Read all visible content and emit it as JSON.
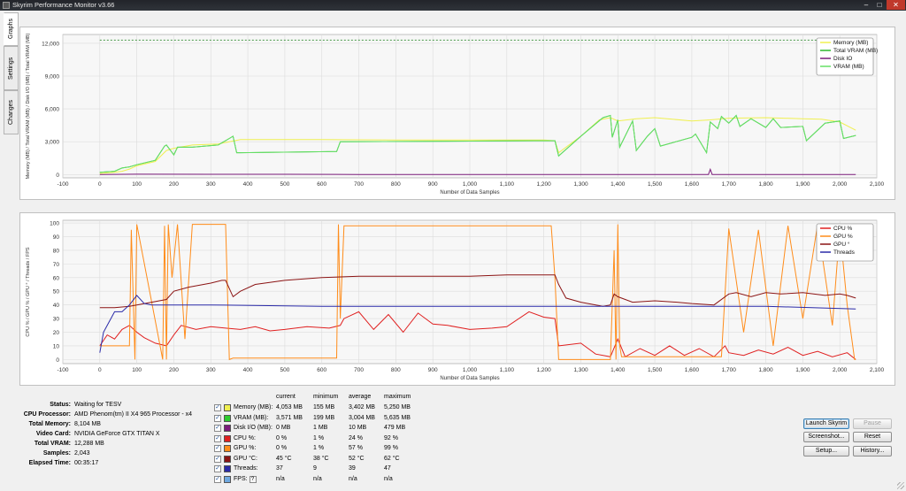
{
  "window": {
    "title": "Skyrim Performance Monitor v3.66",
    "minimize_glyph": "–",
    "maximize_glyph": "□",
    "close_glyph": "✕"
  },
  "tabs": [
    {
      "label": "Graphs",
      "active": true
    },
    {
      "label": "Settings",
      "active": false
    },
    {
      "label": "Changes",
      "active": false
    }
  ],
  "chart_data": [
    {
      "type": "line",
      "ylabel": "Memory (MB) / Total VRAM (MB) / Disk I/O (MB) / Total VRAM (MB)",
      "xlabel": "Number of Data Samples",
      "xlim": [
        -100,
        2100
      ],
      "ylim": [
        -300,
        12800
      ],
      "x_ticks": [
        "-100",
        "0",
        "100",
        "200",
        "300",
        "400",
        "500",
        "600",
        "700",
        "800",
        "900",
        "1,000",
        "1,100",
        "1,200",
        "1,300",
        "1,400",
        "1,500",
        "1,600",
        "1,700",
        "1,800",
        "1,900",
        "2,000",
        "2,100"
      ],
      "y_ticks": [
        "0",
        "3,000",
        "6,000",
        "9,000",
        "12,000"
      ],
      "grid": true,
      "legend_position": "top-right",
      "reference_line": {
        "value": 12288,
        "color": "#2e8b2e"
      },
      "series": [
        {
          "name": "Memory (MB)",
          "color": "#f0f050",
          "x": [
            0,
            40,
            60,
            80,
            100,
            150,
            180,
            200,
            250,
            320,
            350,
            380,
            400,
            600,
            800,
            1000,
            1200,
            1230,
            1240,
            1300,
            1350,
            1380,
            1400,
            1450,
            1500,
            1600,
            1650,
            1700,
            1800,
            1900,
            1950,
            2000,
            2043
          ],
          "y": [
            100,
            200,
            300,
            500,
            800,
            1200,
            2200,
            2400,
            2700,
            2800,
            3000,
            3200,
            3200,
            3200,
            3150,
            3150,
            3150,
            3100,
            2000,
            3500,
            5000,
            5200,
            4900,
            5100,
            5200,
            4900,
            5000,
            5150,
            5200,
            5100,
            5050,
            4800,
            4053
          ]
        },
        {
          "name": "Total VRAM (MB)",
          "color": "#2db82d",
          "x": [
            0,
            40,
            60,
            80,
            100,
            150,
            175,
            180,
            200,
            210,
            250,
            320,
            360,
            370,
            380,
            640,
            650,
            1230,
            1240,
            1300,
            1360,
            1380,
            1385,
            1400,
            1405,
            1440,
            1450,
            1480,
            1500,
            1515,
            1600,
            1610,
            1640,
            1650,
            1670,
            1680,
            1700,
            1720,
            1730,
            1760,
            1800,
            1820,
            1840,
            1900,
            1910,
            1960,
            2000,
            2010,
            2043
          ],
          "y": [
            200,
            300,
            600,
            700,
            900,
            1300,
            2600,
            2700,
            1800,
            2500,
            2500,
            2700,
            3500,
            2000,
            2000,
            2100,
            3000,
            3100,
            1700,
            3500,
            5200,
            5400,
            3400,
            5000,
            2500,
            4900,
            2200,
            3500,
            4200,
            2600,
            3400,
            3700,
            2000,
            4800,
            4200,
            5300,
            4700,
            5400,
            4400,
            5100,
            4300,
            5100,
            4300,
            4400,
            3100,
            4700,
            4900,
            3300,
            3571
          ]
        },
        {
          "name": "Disk IO",
          "color": "#7b1c7b",
          "x": [
            0,
            100,
            300,
            500,
            700,
            900,
            1100,
            1300,
            1500,
            1645,
            1650,
            1655,
            1800,
            2043
          ],
          "y": [
            0,
            30,
            20,
            20,
            10,
            10,
            10,
            10,
            10,
            10,
            479,
            10,
            10,
            0
          ]
        },
        {
          "name": "VRAM (MB)",
          "color": "#66e066",
          "x": [
            0,
            40,
            60,
            80,
            100,
            150,
            175,
            180,
            200,
            210,
            250,
            320,
            360,
            370,
            380,
            640,
            650,
            1230,
            1240,
            1300,
            1360,
            1380,
            1385,
            1400,
            1405,
            1440,
            1450,
            1480,
            1500,
            1515,
            1600,
            1610,
            1640,
            1650,
            1670,
            1680,
            1700,
            1720,
            1730,
            1760,
            1800,
            1820,
            1840,
            1900,
            1910,
            1960,
            2000,
            2010,
            2043
          ],
          "y": [
            200,
            300,
            600,
            700,
            900,
            1300,
            2600,
            2700,
            1800,
            2500,
            2500,
            2700,
            3500,
            2000,
            2000,
            2100,
            3000,
            3100,
            1700,
            3500,
            5200,
            5400,
            3400,
            5000,
            2500,
            4900,
            2200,
            3500,
            4200,
            2600,
            3400,
            3700,
            2000,
            4800,
            4200,
            5300,
            4700,
            5400,
            4400,
            5100,
            4300,
            5100,
            4300,
            4400,
            3100,
            4700,
            4900,
            3300,
            3571
          ]
        }
      ]
    },
    {
      "type": "line",
      "ylabel": "CPU % / GPU % / GPU ° / Threads / FPS",
      "xlabel": "Number of Data Samples",
      "xlim": [
        -100,
        2100
      ],
      "ylim": [
        -3,
        102
      ],
      "x_ticks": [
        "-100",
        "0",
        "100",
        "200",
        "300",
        "400",
        "500",
        "600",
        "700",
        "800",
        "900",
        "1,000",
        "1,100",
        "1,200",
        "1,300",
        "1,400",
        "1,500",
        "1,600",
        "1,700",
        "1,800",
        "1,900",
        "2,000",
        "2,100"
      ],
      "y_ticks": [
        "0",
        "10",
        "20",
        "30",
        "40",
        "50",
        "60",
        "70",
        "80",
        "90",
        "100"
      ],
      "grid": true,
      "legend_position": "top-right",
      "series": [
        {
          "name": "CPU %",
          "color": "#e02020",
          "x": [
            0,
            20,
            40,
            60,
            80,
            100,
            120,
            150,
            180,
            200,
            220,
            260,
            300,
            340,
            380,
            420,
            460,
            500,
            560,
            620,
            650,
            660,
            700,
            740,
            780,
            820,
            860,
            900,
            940,
            1000,
            1060,
            1100,
            1160,
            1200,
            1230,
            1240,
            1300,
            1340,
            1380,
            1400,
            1420,
            1460,
            1500,
            1540,
            1580,
            1620,
            1660,
            1690,
            1700,
            1740,
            1780,
            1820,
            1860,
            1900,
            1940,
            1980,
            2020,
            2043
          ],
          "y": [
            10,
            18,
            15,
            22,
            25,
            20,
            16,
            12,
            10,
            18,
            25,
            22,
            24,
            23,
            22,
            24,
            21,
            22,
            24,
            23,
            25,
            30,
            35,
            22,
            33,
            20,
            34,
            26,
            25,
            22,
            23,
            24,
            35,
            31,
            30,
            10,
            12,
            4,
            2,
            15,
            2,
            8,
            3,
            10,
            3,
            8,
            2,
            10,
            5,
            3,
            7,
            4,
            9,
            3,
            6,
            2,
            5,
            0
          ]
        },
        {
          "name": "GPU %",
          "color": "#ff8c1a",
          "x": [
            0,
            80,
            85,
            95,
            100,
            170,
            175,
            180,
            185,
            195,
            210,
            230,
            250,
            340,
            350,
            360,
            640,
            645,
            650,
            660,
            1200,
            1220,
            1230,
            1240,
            1300,
            1380,
            1390,
            1395,
            1400,
            1405,
            1410,
            1680,
            1700,
            1740,
            1780,
            1820,
            1860,
            1900,
            1940,
            1980,
            2000,
            2020,
            2040,
            2043
          ],
          "y": [
            10,
            10,
            95,
            0,
            99,
            0,
            98,
            0,
            99,
            60,
            99,
            15,
            99,
            99,
            0,
            1,
            1,
            99,
            30,
            98,
            98,
            98,
            60,
            0,
            0,
            0,
            80,
            0,
            99,
            10,
            2,
            2,
            96,
            20,
            95,
            10,
            98,
            30,
            99,
            25,
            96,
            40,
            0,
            0
          ]
        },
        {
          "name": "GPU °",
          "color": "#8b1414",
          "x": [
            0,
            40,
            80,
            100,
            140,
            180,
            200,
            240,
            300,
            330,
            340,
            360,
            380,
            420,
            500,
            600,
            700,
            800,
            900,
            1000,
            1100,
            1200,
            1230,
            1240,
            1260,
            1300,
            1360,
            1380,
            1390,
            1400,
            1440,
            1500,
            1560,
            1600,
            1660,
            1700,
            1720,
            1760,
            1800,
            1840,
            1900,
            1960,
            2000,
            2020,
            2043
          ],
          "y": [
            38,
            38,
            39,
            40,
            42,
            44,
            50,
            53,
            56,
            58,
            58,
            46,
            50,
            55,
            58,
            60,
            61,
            61,
            61,
            61,
            62,
            62,
            62,
            55,
            45,
            42,
            39,
            40,
            48,
            46,
            42,
            43,
            42,
            41,
            40,
            48,
            49,
            46,
            49,
            48,
            49,
            47,
            48,
            47,
            45
          ]
        },
        {
          "name": "Threads",
          "color": "#2a2aa8",
          "x": [
            0,
            10,
            20,
            40,
            60,
            80,
            100,
            120,
            140,
            180,
            300,
            600,
            900,
            1200,
            1500,
            1800,
            2043
          ],
          "y": [
            5,
            20,
            25,
            35,
            35,
            40,
            47,
            41,
            40,
            40,
            40,
            39,
            39,
            39,
            39,
            39,
            37
          ]
        }
      ]
    }
  ],
  "info": [
    {
      "label": "Status:",
      "value": "Waiting for TESV"
    },
    {
      "label": "CPU Processor:",
      "value": "AMD Phenom(tm) II X4 965 Processor - x4"
    },
    {
      "label": "Total Memory:",
      "value": "8,104 MB"
    },
    {
      "label": "Video Card:",
      "value": "NVIDIA GeForce GTX TITAN X"
    },
    {
      "label": "Total VRAM:",
      "value": "12,288 MB"
    },
    {
      "label": "Samples:",
      "value": "2,043"
    },
    {
      "label": "Elapsed Time:",
      "value": "00:35:17"
    }
  ],
  "metrics": {
    "headers": [
      "current",
      "minimum",
      "average",
      "maximum"
    ],
    "rows": [
      {
        "name": "Memory (MB):",
        "color": "#f0f050",
        "checked": true,
        "current": "4,053 MB",
        "minimum": "155 MB",
        "average": "3,402 MB",
        "maximum": "5,250 MB"
      },
      {
        "name": "VRAM (MB):",
        "color": "#2ecc2e",
        "checked": true,
        "current": "3,571 MB",
        "minimum": "199 MB",
        "average": "3,004 MB",
        "maximum": "5,635 MB"
      },
      {
        "name": "Disk I/O (MB):",
        "color": "#7b1c7b",
        "checked": true,
        "current": "0 MB",
        "minimum": "1 MB",
        "average": "10 MB",
        "maximum": "479 MB"
      },
      {
        "name": "CPU %:",
        "color": "#e02020",
        "checked": true,
        "current": "0 %",
        "minimum": "1 %",
        "average": "24 %",
        "maximum": "92 %"
      },
      {
        "name": "GPU %:",
        "color": "#ff8c1a",
        "checked": true,
        "current": "0 %",
        "minimum": "1 %",
        "average": "57 %",
        "maximum": "99 %"
      },
      {
        "name": "GPU °C:",
        "color": "#8b1414",
        "checked": true,
        "current": "45 °C",
        "minimum": "38 °C",
        "average": "52 °C",
        "maximum": "62 °C"
      },
      {
        "name": "Threads:",
        "color": "#2a2aa8",
        "checked": true,
        "current": "37",
        "minimum": "9",
        "average": "39",
        "maximum": "47"
      },
      {
        "name": "FPS:",
        "color": "#6fa8e0",
        "checked": true,
        "current": "n/a",
        "minimum": "n/a",
        "average": "n/a",
        "maximum": "n/a",
        "help": "?"
      }
    ]
  },
  "buttons": {
    "launch": "Launch Skyrim",
    "pause": "Pause",
    "screenshot": "Screenshot...",
    "reset": "Reset",
    "setup": "Setup...",
    "history": "History..."
  }
}
